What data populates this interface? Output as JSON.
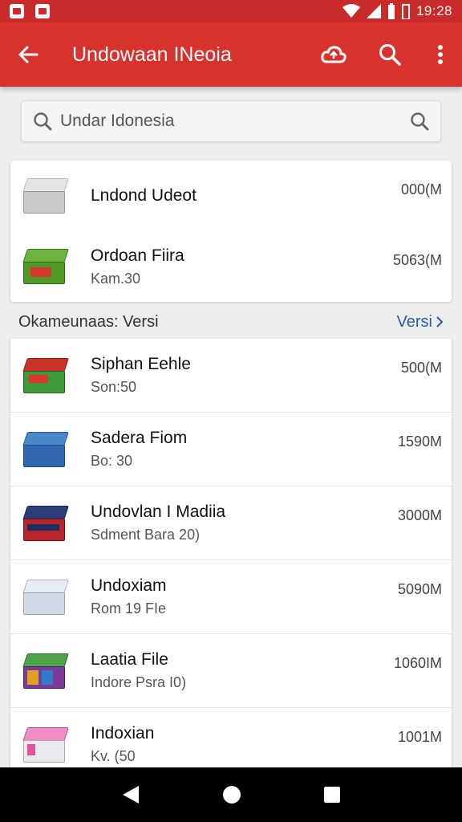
{
  "status_bar": {
    "time": "19:28"
  },
  "app_bar": {
    "title": "Undowaan INeoia"
  },
  "search": {
    "value": "Undar Idonesia"
  },
  "top_items": [
    {
      "title": "Lndond Udeot",
      "subtitle": "",
      "size": "000(M"
    },
    {
      "title": "Ordoan Fiira",
      "subtitle": "Kam.30",
      "size": "5063(M"
    }
  ],
  "section": {
    "label": "Okameunaas:  Versi",
    "link": "Versi"
  },
  "list_items": [
    {
      "title": "Siphan Eehle",
      "subtitle": "Son:50",
      "size": "500(M"
    },
    {
      "title": "Sadera Fiom",
      "subtitle": "Bo: 30",
      "size": "1590M"
    },
    {
      "title": "Undovlan I Madiia",
      "subtitle": "Sdment Bara 20)",
      "size": "3000M"
    },
    {
      "title": "Undoxiam",
      "subtitle": "Rom 19 FIe",
      "size": "5090M"
    },
    {
      "title": "Laatia File",
      "subtitle": "Indore Psra I0)",
      "size": "1060IM"
    },
    {
      "title": "Indoxian",
      "subtitle": "Kv. (50",
      "size": "1001M"
    }
  ],
  "colors": {
    "status": "#c92a2a",
    "app_bar": "#d7322e",
    "link": "#2a5d9f"
  }
}
